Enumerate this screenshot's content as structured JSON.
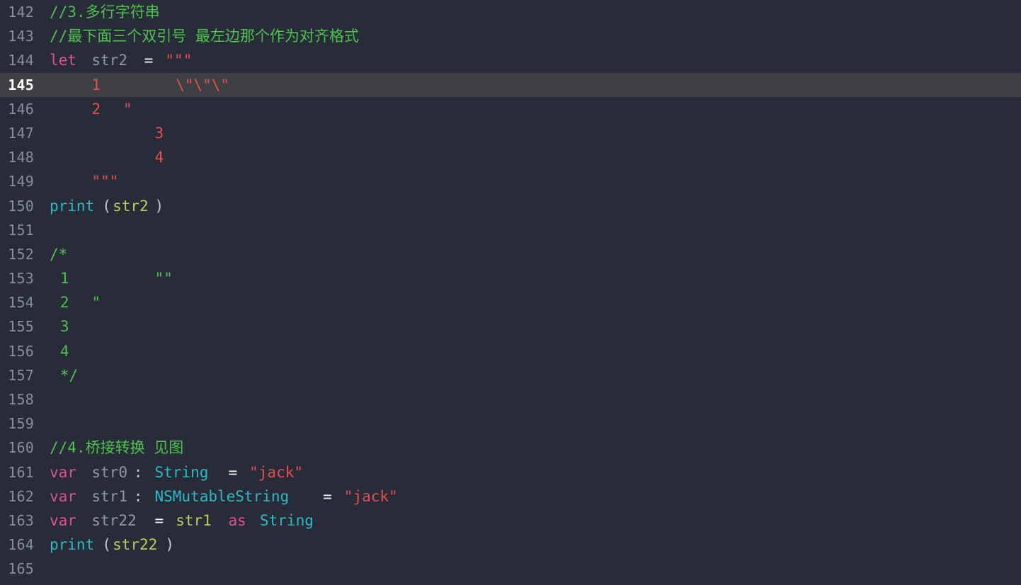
{
  "editor": {
    "name": "swift-code-editor",
    "language": "Swift",
    "first_line_number": 142,
    "active_line_number": 145,
    "colors": {
      "background": "#282c38",
      "active_line_background": "#3f4044",
      "gutter_text": "#868d9e",
      "active_gutter_text": "#ffffff",
      "comment": "#4ec24e",
      "keyword": "#e0508f",
      "variable": "#8f98a8",
      "identifier": "#bfcb5c",
      "type": "#2bbac5",
      "function": "#2bbac5",
      "string": "#e3504f",
      "punctuation": "#c3c9d6",
      "operator": "#ffffff"
    },
    "char_width": 14.85,
    "line_height": 34.2
  },
  "lines": [
    {
      "number": "142",
      "active": false,
      "tokens": [
        {
          "text": "//3.多行字符串",
          "type": "comment",
          "col": 0
        }
      ]
    },
    {
      "number": "143",
      "active": false,
      "tokens": [
        {
          "text": "//最下面三个双引号 最左边那个作为对齐格式",
          "type": "comment",
          "col": 0
        }
      ]
    },
    {
      "number": "144",
      "active": false,
      "tokens": [
        {
          "text": "let",
          "type": "keyword",
          "col": 0
        },
        {
          "text": "str2",
          "type": "var",
          "col": 4
        },
        {
          "text": "=",
          "type": "op",
          "col": 9
        },
        {
          "text": "\"\"\"",
          "type": "string",
          "col": 11
        }
      ]
    },
    {
      "number": "145",
      "active": true,
      "tokens": [
        {
          "text": "1",
          "type": "string",
          "col": 4
        },
        {
          "text": "\\\"\\\"\\\"",
          "type": "string",
          "col": 12
        }
      ]
    },
    {
      "number": "146",
      "active": false,
      "tokens": [
        {
          "text": "2",
          "type": "string",
          "col": 4
        },
        {
          "text": "\"",
          "type": "string",
          "col": 7
        }
      ]
    },
    {
      "number": "147",
      "active": false,
      "tokens": [
        {
          "text": "3",
          "type": "string",
          "col": 10
        }
      ]
    },
    {
      "number": "148",
      "active": false,
      "tokens": [
        {
          "text": "4",
          "type": "string",
          "col": 10
        }
      ]
    },
    {
      "number": "149",
      "active": false,
      "tokens": [
        {
          "text": "\"\"\"",
          "type": "string",
          "col": 4
        }
      ]
    },
    {
      "number": "150",
      "active": false,
      "tokens": [
        {
          "text": "print",
          "type": "func",
          "col": 0
        },
        {
          "text": "(",
          "type": "punct",
          "col": 5
        },
        {
          "text": "str2",
          "type": "ident",
          "col": 6
        },
        {
          "text": ")",
          "type": "punct",
          "col": 10
        }
      ]
    },
    {
      "number": "151",
      "active": false,
      "tokens": []
    },
    {
      "number": "152",
      "active": false,
      "tokens": [
        {
          "text": "/*",
          "type": "comment",
          "col": 0
        }
      ]
    },
    {
      "number": "153",
      "active": false,
      "tokens": [
        {
          "text": "1",
          "type": "comment",
          "col": 1
        },
        {
          "text": "\"\"",
          "type": "comment",
          "col": 10
        }
      ]
    },
    {
      "number": "154",
      "active": false,
      "tokens": [
        {
          "text": "2",
          "type": "comment",
          "col": 1
        },
        {
          "text": "\"",
          "type": "comment",
          "col": 4
        }
      ]
    },
    {
      "number": "155",
      "active": false,
      "tokens": [
        {
          "text": "3",
          "type": "comment",
          "col": 1
        }
      ]
    },
    {
      "number": "156",
      "active": false,
      "tokens": [
        {
          "text": "4",
          "type": "comment",
          "col": 1
        }
      ]
    },
    {
      "number": "157",
      "active": false,
      "tokens": [
        {
          "text": "*/",
          "type": "comment",
          "col": 1
        }
      ]
    },
    {
      "number": "158",
      "active": false,
      "tokens": []
    },
    {
      "number": "159",
      "active": false,
      "tokens": []
    },
    {
      "number": "160",
      "active": false,
      "tokens": [
        {
          "text": "//4.桥接转换 见图",
          "type": "comment",
          "col": 0
        }
      ]
    },
    {
      "number": "161",
      "active": false,
      "tokens": [
        {
          "text": "var",
          "type": "keyword",
          "col": 0
        },
        {
          "text": "str0",
          "type": "var",
          "col": 4
        },
        {
          "text": ":",
          "type": "punct",
          "col": 8
        },
        {
          "text": "String",
          "type": "type",
          "col": 10
        },
        {
          "text": "=",
          "type": "op",
          "col": 17
        },
        {
          "text": "\"jack\"",
          "type": "string",
          "col": 19
        }
      ]
    },
    {
      "number": "162",
      "active": false,
      "tokens": [
        {
          "text": "var",
          "type": "keyword",
          "col": 0
        },
        {
          "text": "str1",
          "type": "var",
          "col": 4
        },
        {
          "text": ":",
          "type": "punct",
          "col": 8
        },
        {
          "text": "NSMutableString",
          "type": "type",
          "col": 10
        },
        {
          "text": "=",
          "type": "op",
          "col": 26
        },
        {
          "text": "\"jack\"",
          "type": "string",
          "col": 28
        }
      ]
    },
    {
      "number": "163",
      "active": false,
      "tokens": [
        {
          "text": "var",
          "type": "keyword",
          "col": 0
        },
        {
          "text": "str22",
          "type": "var",
          "col": 4
        },
        {
          "text": "=",
          "type": "op",
          "col": 10
        },
        {
          "text": "str1",
          "type": "ident",
          "col": 12
        },
        {
          "text": "as",
          "type": "keyword",
          "col": 17
        },
        {
          "text": "String",
          "type": "type",
          "col": 20
        }
      ]
    },
    {
      "number": "164",
      "active": false,
      "tokens": [
        {
          "text": "print",
          "type": "func",
          "col": 0
        },
        {
          "text": "(",
          "type": "punct",
          "col": 5
        },
        {
          "text": "str22",
          "type": "ident",
          "col": 6
        },
        {
          "text": ")",
          "type": "punct",
          "col": 11
        }
      ]
    },
    {
      "number": "165",
      "active": false,
      "tokens": []
    }
  ]
}
